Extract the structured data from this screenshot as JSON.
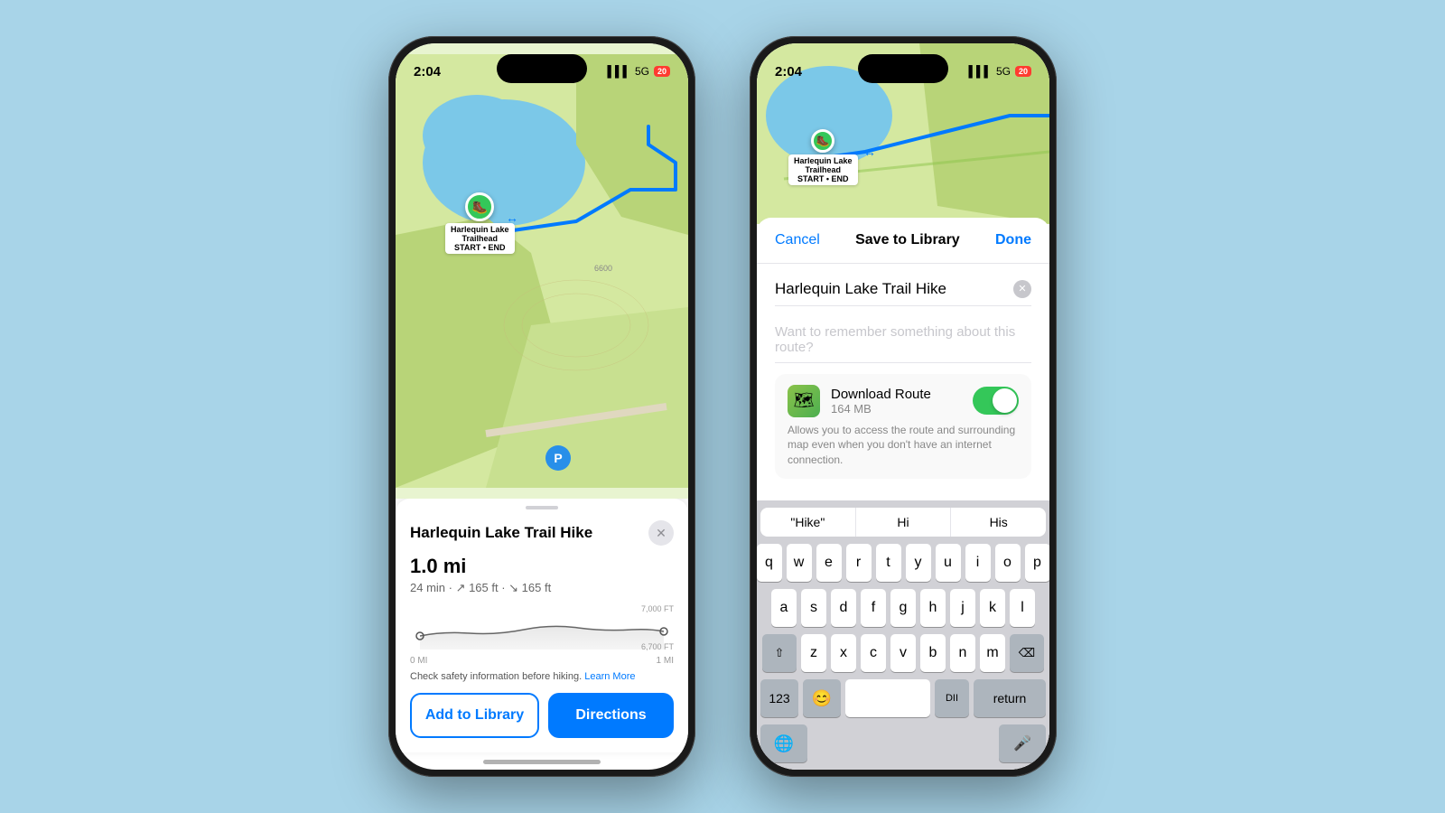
{
  "background": "#a8d4e8",
  "phone1": {
    "status": {
      "time": "2:04",
      "signal": "5G",
      "battery": "20"
    },
    "map": {
      "pin_label_1": "Harlequin Lake",
      "pin_label_2": "Trailhead",
      "pin_label_3": "START • END"
    },
    "card": {
      "title": "Harlequin Lake Trail Hike",
      "distance": "1.0 mi",
      "details": "24 min · ↗ 165 ft · ↘ 165 ft",
      "elevation_high": "7,000 FT",
      "elevation_low": "6,700 FT",
      "chart_start": "0 MI",
      "chart_end": "1 MI",
      "safety": "Check safety information before hiking.",
      "learn_more": "Learn More",
      "btn_library": "Add to Library",
      "btn_directions": "Directions"
    }
  },
  "phone2": {
    "status": {
      "time": "2:04",
      "signal": "5G",
      "battery": "20"
    },
    "modal": {
      "cancel": "Cancel",
      "title": "Save to Library",
      "done": "Done",
      "route_name": "Harlequin Lake Trail Hike",
      "note_placeholder": "Want to remember something about this route?",
      "download_title": "Download Route",
      "download_size": "164 MB",
      "download_description": "Allows you to access the route and surrounding map even when you don't have an internet connection.",
      "toggle_on": true
    },
    "keyboard": {
      "suggestions": [
        "\"Hike\"",
        "Hi",
        "His"
      ],
      "row1": [
        "q",
        "w",
        "e",
        "r",
        "t",
        "y",
        "u",
        "i",
        "o",
        "p"
      ],
      "row2": [
        "a",
        "s",
        "d",
        "f",
        "g",
        "h",
        "j",
        "k",
        "l"
      ],
      "row3": [
        "z",
        "x",
        "c",
        "v",
        "b",
        "n",
        "m"
      ],
      "special": {
        "shift": "⇧",
        "delete": "⌫",
        "numbers": "123",
        "emoji": "😊",
        "globe": "🌐",
        "mic": "🎤",
        "return": "return",
        "space": ""
      }
    }
  }
}
